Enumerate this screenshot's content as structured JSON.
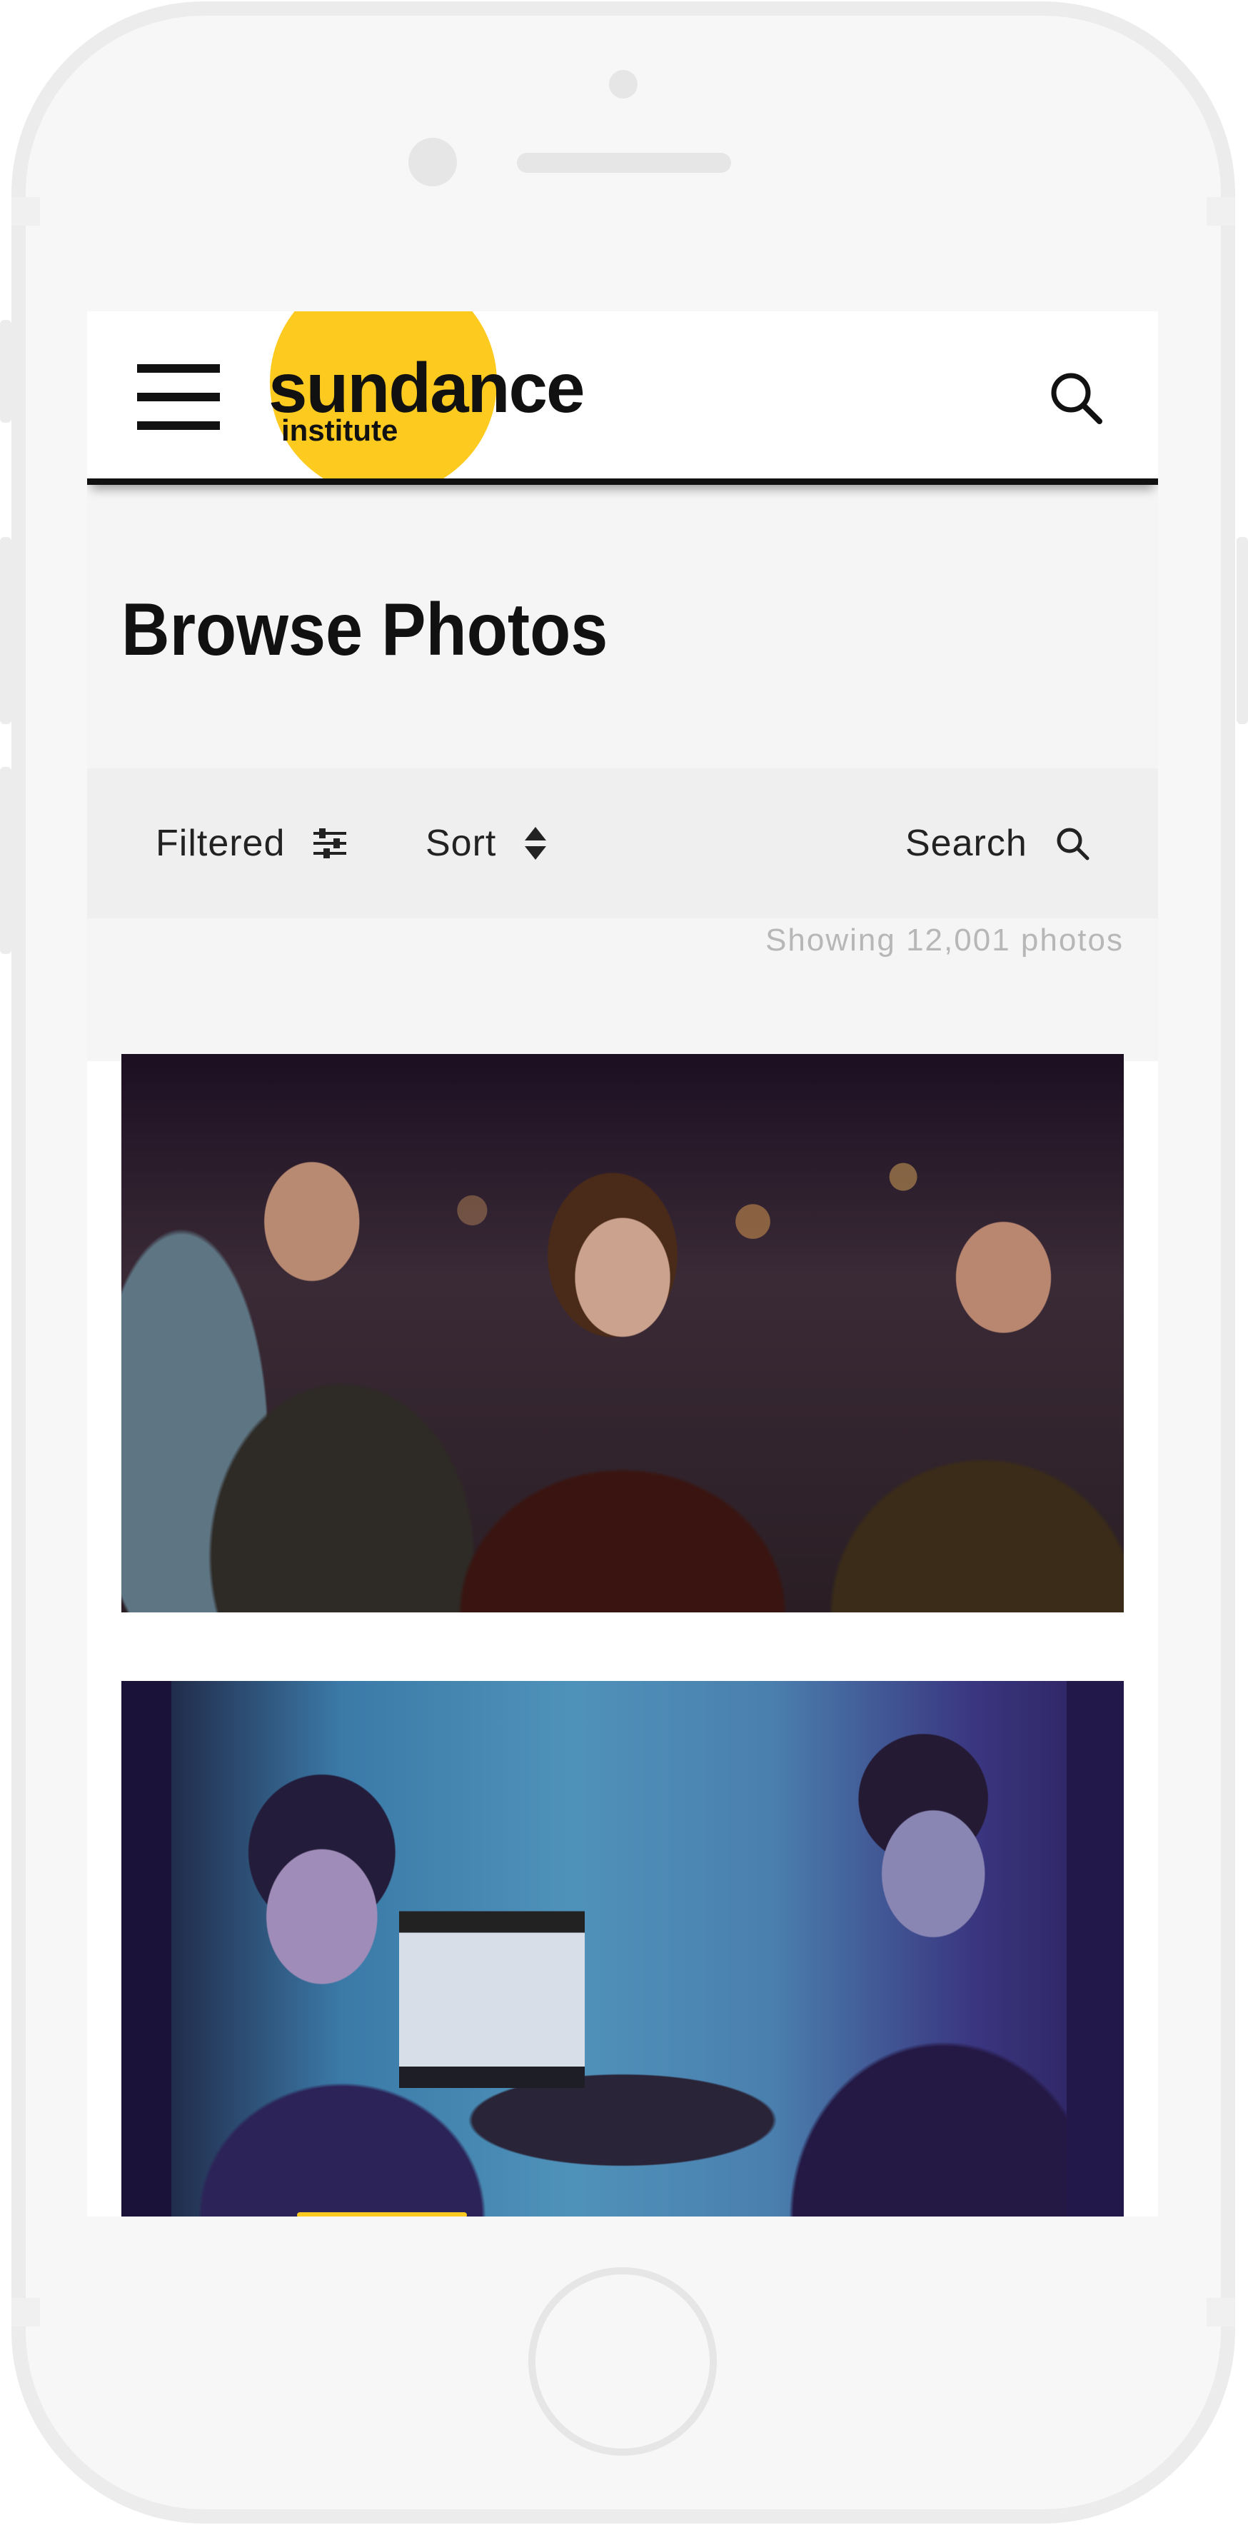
{
  "brand": {
    "name": "sundance",
    "sub": "institute",
    "accent_color": "#fdcb1f"
  },
  "header": {
    "menu_icon": "hamburger-menu-icon",
    "search_icon": "search-icon"
  },
  "page": {
    "title": "Browse Photos"
  },
  "toolbar": {
    "filter_label": "Filtered",
    "filter_icon": "sliders-icon",
    "sort_label": "Sort",
    "sort_icon": "sort-arrows-icon",
    "search_label": "Search",
    "search_icon": "search-icon"
  },
  "results": {
    "count_text": "Showing 12,001 photos"
  },
  "photos": [
    {
      "kind": "photo",
      "subject": "crowd at event"
    },
    {
      "kind": "photo",
      "subject": "two men in blue-lit room"
    }
  ]
}
